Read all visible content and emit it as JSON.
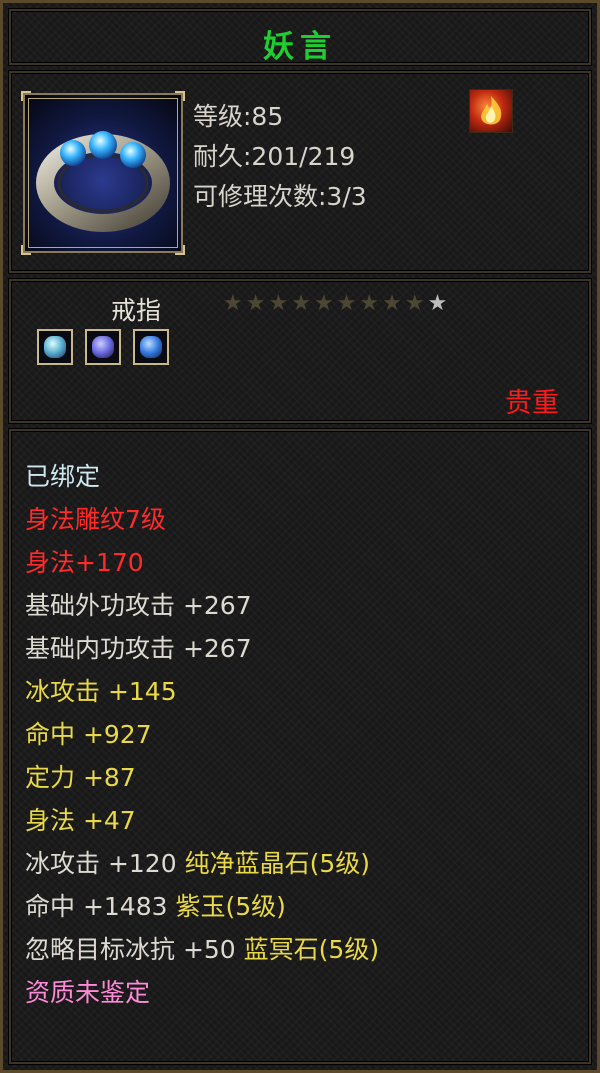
{
  "title": "妖言",
  "item": {
    "level_line": "等级:85",
    "durability_line": "耐久:201/219",
    "repair_line": "可修理次数:3/3",
    "type": "戒指",
    "rarity": "贵重",
    "star_rating": {
      "lit": 9,
      "total": 10
    },
    "icon": "ring-with-blue-gems",
    "badge_icon": "flame-skill-icon",
    "socket_gems": [
      "aqua-gem-icon",
      "purple-gem-icon",
      "blue-gem-icon"
    ]
  },
  "attributes": {
    "bound": "已绑定",
    "engrave": "身法雕纹7级",
    "engrave_bonus": "身法+170",
    "base_ext_attack": "基础外功攻击 +267",
    "base_int_attack": "基础内功攻击 +267",
    "ice_attack": "冰攻击 +145",
    "hit": "命中 +927",
    "concentration": "定力 +87",
    "agility": "身法 +47",
    "gem1_stat": "冰攻击 +120 ",
    "gem1_name": "纯净蓝晶石(5级)",
    "gem2_stat": "命中 +1483 ",
    "gem2_name": "紫玉(5级)",
    "gem3_stat": "忽略目标冰抗 +50 ",
    "gem3_name": "蓝冥石(5级)",
    "aptitude": "资质未鉴定"
  },
  "colors": {
    "title": "#1fcf2f",
    "bound": "#cfe8f0",
    "engrave": "#ff2a2a",
    "base_stat": "#dedad2",
    "bonus_stat": "#e8d84a",
    "aptitude": "#ff8ad8",
    "rarity": "#ff1a1a"
  }
}
